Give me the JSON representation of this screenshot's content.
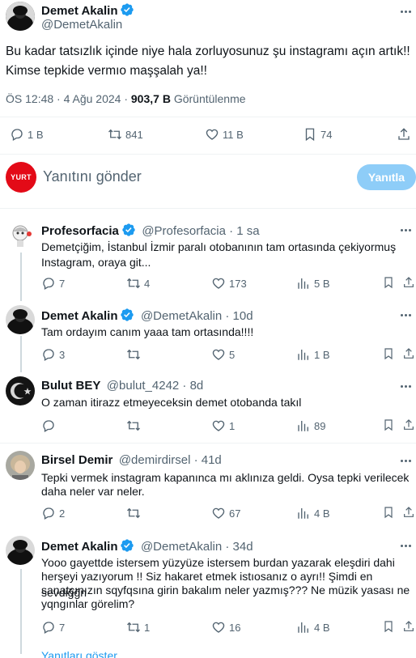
{
  "main_tweet": {
    "author_name": "Demet Akalin",
    "handle": "@DemetAkalin",
    "text_line1": "Bu kadar tatsızlık içinde niye hala zorluyosunuz şu instagramı açın artık!!",
    "text_line2": "Kimse tepkide vermıo maşşalah ya!!",
    "time": "ÖS 12:48 · 4 Ağu 2024 · ",
    "views": "903,7 B",
    "views_label": " Görüntülenme",
    "replies": "1 B",
    "retweets": "841",
    "likes": "11 B",
    "bookmarks": "74"
  },
  "reply_box": {
    "avatar_text": "YURT",
    "placeholder": "Yanıtını gönder",
    "button_label": "Yanıtla"
  },
  "replies": [
    {
      "name": "Profesorfacia",
      "handle": "@Profesorfacia · 1 sa",
      "line1": "Demetçiğim, İstanbul İzmir paralı otobanının tam ortasında çekiyormuş",
      "line2": "Instagram, oraya git...",
      "replies": "7",
      "retweets": "4",
      "likes": "173",
      "views": "5 B"
    },
    {
      "name": "Demet Akalin",
      "handle": "@DemetAkalin · 10d",
      "line1": "Tam ordayım canım yaaa tam ortasında!!!!",
      "replies": "3",
      "retweets": "",
      "likes": "5",
      "views": "1 B"
    },
    {
      "name": "Bulut BEY",
      "handle": "@bulut_4242 · 8d",
      "line1": "O zaman itirazz etmeyeceksin demet otobanda takıl",
      "replies": "",
      "retweets": "",
      "likes": "1",
      "views": "89"
    },
    {
      "name": "Birsel Demir",
      "handle": "@demirdirsel · 41d",
      "line1": "Tepki vermek instagram kapanınca mı aklınıza geldi. Oysa tepki verilecek",
      "line2": "daha neler var neler.",
      "replies": "2",
      "retweets": "",
      "likes": "67",
      "views": "4 B"
    },
    {
      "name": "Demet Akalin",
      "handle": "@DemetAkalin · 34d",
      "line1": "Yooo gayettde istersem yüzyüze istersem burdan yazarak eleşdiri dahi",
      "line2": "herşeyi yazıyorum !! Siz hakaret etmek istıosanız o ayrı!! Şimdi en sevdiğğn",
      "line3": "sanatçınızın sqyfqsına girin bakalım neler yazmış??? Ne müzik yasası ne",
      "line4": "yqngınlar görelim?",
      "replies": "7",
      "retweets": "1",
      "likes": "16",
      "views": "4 B"
    }
  ],
  "show_replies": "Yanıtları göster",
  "colors": {
    "accent": "#1d9bf0",
    "button_disabled": "#8ecdf8",
    "secondary_text": "#536471",
    "divider": "#eff3f4"
  }
}
